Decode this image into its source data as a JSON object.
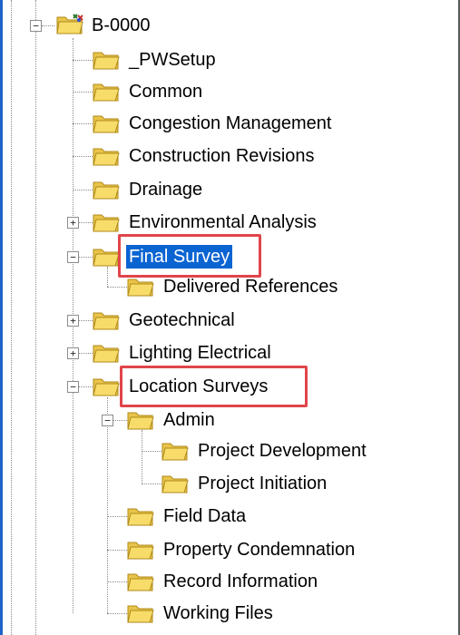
{
  "tree": {
    "root": {
      "label": "B-0000",
      "expanded": true,
      "icon": "project-folder-icon"
    },
    "items": [
      {
        "label": "_PWSetup",
        "expander": "none"
      },
      {
        "label": "Common",
        "expander": "none"
      },
      {
        "label": "Congestion Management",
        "expander": "none"
      },
      {
        "label": "Construction Revisions",
        "expander": "none"
      },
      {
        "label": "Drainage",
        "expander": "none"
      },
      {
        "label": "Environmental Analysis",
        "expander": "+"
      },
      {
        "label": "Final Survey",
        "expander": "−",
        "selected": true,
        "highlighted": true
      },
      {
        "label": "Delivered References",
        "expander": "none"
      },
      {
        "label": "Geotechnical",
        "expander": "+"
      },
      {
        "label": "Lighting Electrical",
        "expander": "+"
      },
      {
        "label": "Location Surveys",
        "expander": "−",
        "highlighted": true
      },
      {
        "label": "Admin",
        "expander": "−"
      },
      {
        "label": "Project Development",
        "expander": "none"
      },
      {
        "label": "Project Initiation",
        "expander": "none"
      },
      {
        "label": "Field Data",
        "expander": "none"
      },
      {
        "label": "Property Condemnation",
        "expander": "none"
      },
      {
        "label": "Record Information",
        "expander": "none"
      },
      {
        "label": "Working Files",
        "expander": "none"
      }
    ]
  },
  "colors": {
    "selection": "#0a64d2",
    "highlight_box": "#e0454a",
    "folder": "#f2d25a"
  }
}
